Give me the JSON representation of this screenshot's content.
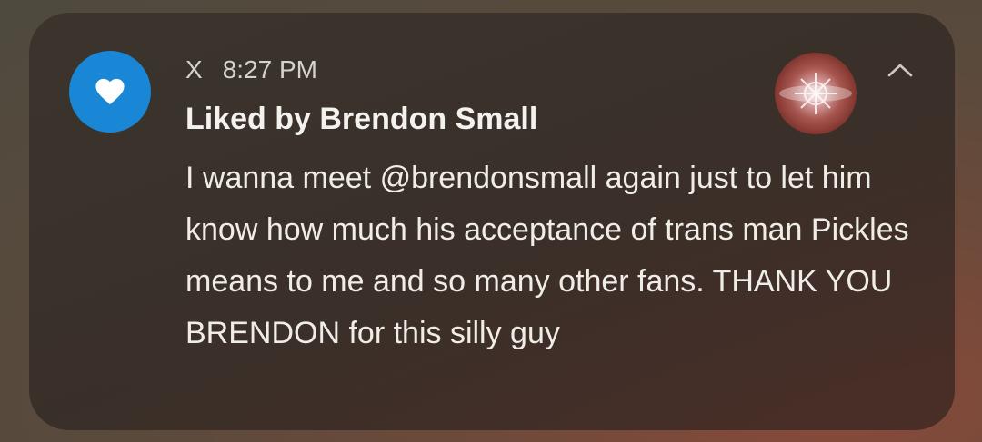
{
  "notification": {
    "app_name": "X",
    "time": "8:27 PM",
    "title": "Liked by Brendon Small",
    "body": "I wanna meet @brendonsmall again just to let him know how much his acceptance of trans man Pickles means to me and so many other fans. THANK YOU BRENDON for this silly guy",
    "app_icon": "heart-icon",
    "collapse_icon": "chevron-up-icon",
    "accent_color": "#1a86d6"
  }
}
